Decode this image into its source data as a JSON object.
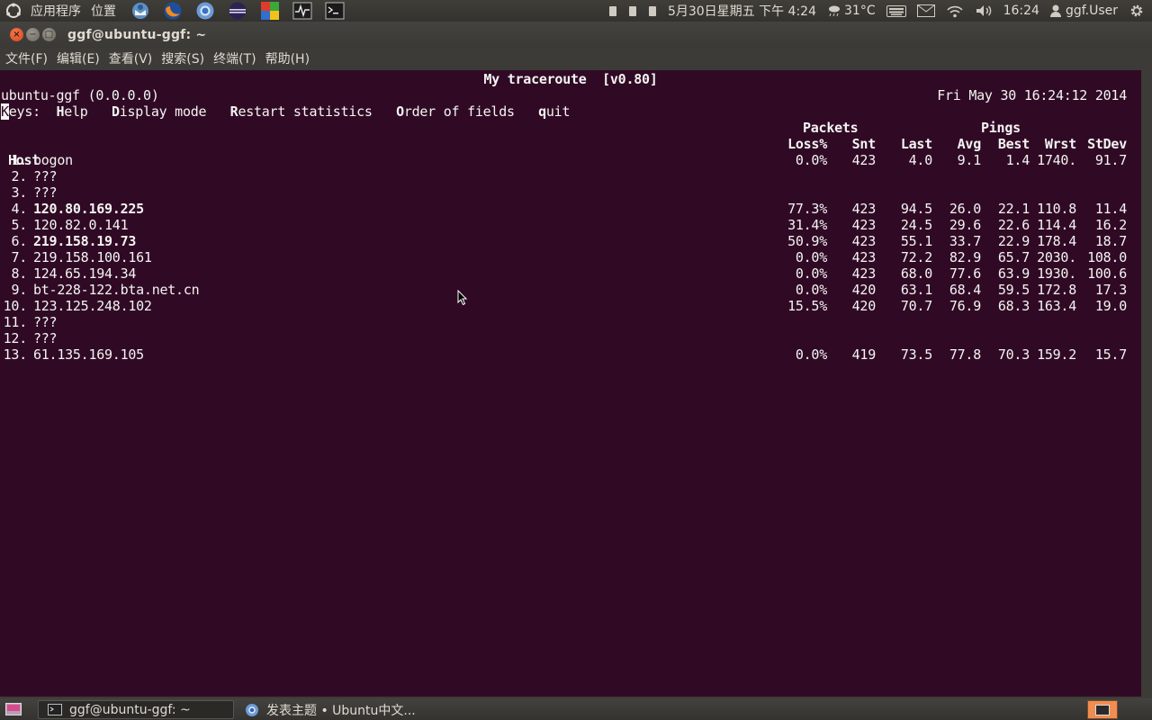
{
  "top_panel": {
    "apps_label": "应用程序",
    "places_label": "位置",
    "datetime": "5月30日星期五 下午 4:24",
    "weather": "31°C",
    "clock": "16:24",
    "user": "ggf.User"
  },
  "window": {
    "title": "ggf@ubuntu-ggf: ~",
    "menu": [
      "文件(F)",
      "编辑(E)",
      "查看(V)",
      "搜索(S)",
      "终端(T)",
      "帮助(H)"
    ]
  },
  "terminal": {
    "app_title": "My traceroute  [v0.80]",
    "source_host": "ubuntu-ggf (0.0.0.0)",
    "timestamp": "Fri May 30 16:24:12 2014",
    "keys": {
      "keys_first": "K",
      "keys_rest": "eys:",
      "help_key": "H",
      "help_rest": "elp",
      "display_key": "D",
      "display_rest": "isplay mode",
      "restart_key": "R",
      "restart_rest": "estart statistics",
      "order_key": "O",
      "order_rest": "rder of fields",
      "quit_key": "q",
      "quit_rest": "uit"
    },
    "group_headers": {
      "packets": "Packets",
      "pings": "Pings"
    },
    "columns": [
      "Host",
      "Loss%",
      "Snt",
      "Last",
      "Avg",
      "Best",
      "Wrst",
      "StDev"
    ],
    "rows": [
      {
        "num": "1.",
        "host": "bogon",
        "bold": false,
        "loss": "0.0%",
        "snt": "423",
        "last": "4.0",
        "avg": "9.1",
        "best": "1.4",
        "wrst": "1740.",
        "stdev": "91.7"
      },
      {
        "num": "2.",
        "host": "???",
        "bold": false,
        "loss": "",
        "snt": "",
        "last": "",
        "avg": "",
        "best": "",
        "wrst": "",
        "stdev": ""
      },
      {
        "num": "3.",
        "host": "???",
        "bold": false,
        "loss": "",
        "snt": "",
        "last": "",
        "avg": "",
        "best": "",
        "wrst": "",
        "stdev": ""
      },
      {
        "num": "4.",
        "host": "120.80.169.225",
        "bold": true,
        "loss": "77.3%",
        "snt": "423",
        "last": "94.5",
        "avg": "26.0",
        "best": "22.1",
        "wrst": "110.8",
        "stdev": "11.4"
      },
      {
        "num": "5.",
        "host": "120.82.0.141",
        "bold": false,
        "loss": "31.4%",
        "snt": "423",
        "last": "24.5",
        "avg": "29.6",
        "best": "22.6",
        "wrst": "114.4",
        "stdev": "16.2"
      },
      {
        "num": "6.",
        "host": "219.158.19.73",
        "bold": true,
        "loss": "50.9%",
        "snt": "423",
        "last": "55.1",
        "avg": "33.7",
        "best": "22.9",
        "wrst": "178.4",
        "stdev": "18.7"
      },
      {
        "num": "7.",
        "host": "219.158.100.161",
        "bold": false,
        "loss": "0.0%",
        "snt": "423",
        "last": "72.2",
        "avg": "82.9",
        "best": "65.7",
        "wrst": "2030.",
        "stdev": "108.0"
      },
      {
        "num": "8.",
        "host": "124.65.194.34",
        "bold": false,
        "loss": "0.0%",
        "snt": "423",
        "last": "68.0",
        "avg": "77.6",
        "best": "63.9",
        "wrst": "1930.",
        "stdev": "100.6"
      },
      {
        "num": "9.",
        "host": "bt-228-122.bta.net.cn",
        "bold": false,
        "loss": "0.0%",
        "snt": "420",
        "last": "63.1",
        "avg": "68.4",
        "best": "59.5",
        "wrst": "172.8",
        "stdev": "17.3"
      },
      {
        "num": "10.",
        "host": "123.125.248.102",
        "bold": false,
        "loss": "15.5%",
        "snt": "420",
        "last": "70.7",
        "avg": "76.9",
        "best": "68.3",
        "wrst": "163.4",
        "stdev": "19.0"
      },
      {
        "num": "11.",
        "host": "???",
        "bold": false,
        "loss": "",
        "snt": "",
        "last": "",
        "avg": "",
        "best": "",
        "wrst": "",
        "stdev": ""
      },
      {
        "num": "12.",
        "host": "???",
        "bold": false,
        "loss": "",
        "snt": "",
        "last": "",
        "avg": "",
        "best": "",
        "wrst": "",
        "stdev": ""
      },
      {
        "num": "13.",
        "host": "61.135.169.105",
        "bold": false,
        "loss": "0.0%",
        "snt": "419",
        "last": "73.5",
        "avg": "77.8",
        "best": "70.3",
        "wrst": "159.2",
        "stdev": "15.7"
      }
    ]
  },
  "taskbar": {
    "tasks": [
      {
        "label": "ggf@ubuntu-ggf: ~",
        "icon": "terminal-icon"
      },
      {
        "label": "发表主题 • Ubuntu中文...",
        "icon": "chromium-icon"
      }
    ]
  },
  "colors": {
    "terminal_bg": "#300a24",
    "terminal_fg": "#f4f4f4",
    "panel_bg": "#3c3b37",
    "close_button": "#e4561f"
  }
}
